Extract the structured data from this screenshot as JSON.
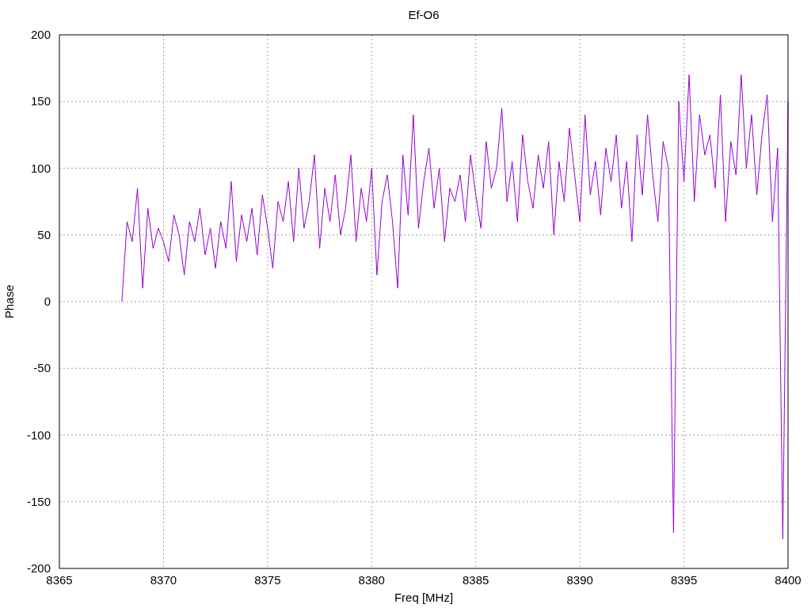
{
  "chart": {
    "chart_data": {
      "type": "line",
      "title": "Ef-O6",
      "xlabel": "Freq [MHz]",
      "ylabel": "Phase",
      "grid": true,
      "xlim": [
        8365,
        8400
      ],
      "ylim": [
        -200,
        200
      ],
      "xticks": [
        8365,
        8370,
        8375,
        8380,
        8385,
        8390,
        8395,
        8400
      ],
      "yticks": [
        -200,
        -150,
        -100,
        -50,
        0,
        50,
        100,
        150,
        200
      ],
      "x": [
        8368,
        8368.25,
        8368.5,
        8368.75,
        8369,
        8369.25,
        8369.5,
        8369.75,
        8370,
        8370.25,
        8370.5,
        8370.75,
        8371,
        8371.25,
        8371.5,
        8371.75,
        8372,
        8372.25,
        8372.5,
        8372.75,
        8373,
        8373.25,
        8373.5,
        8373.75,
        8374,
        8374.25,
        8374.5,
        8374.75,
        8375,
        8375.25,
        8375.5,
        8375.75,
        8376,
        8376.25,
        8376.5,
        8376.75,
        8377,
        8377.25,
        8377.5,
        8377.75,
        8378,
        8378.25,
        8378.5,
        8378.75,
        8379,
        8379.25,
        8379.5,
        8379.75,
        8380,
        8380.25,
        8380.5,
        8380.75,
        8381,
        8381.25,
        8381.5,
        8381.75,
        8382,
        8382.25,
        8382.5,
        8382.75,
        8383,
        8383.25,
        8383.5,
        8383.75,
        8384,
        8384.25,
        8384.5,
        8384.75,
        8385,
        8385.25,
        8385.5,
        8385.75,
        8386,
        8386.25,
        8386.5,
        8386.75,
        8387,
        8387.25,
        8387.5,
        8387.75,
        8388,
        8388.25,
        8388.5,
        8388.75,
        8389,
        8389.25,
        8389.5,
        8389.75,
        8390,
        8390.25,
        8390.5,
        8390.75,
        8391,
        8391.25,
        8391.5,
        8391.75,
        8392,
        8392.25,
        8392.5,
        8392.75,
        8393,
        8393.25,
        8393.5,
        8393.75,
        8394,
        8394.25,
        8394.5,
        8394.75,
        8395,
        8395.25,
        8395.5,
        8395.75,
        8396,
        8396.25,
        8396.5,
        8396.75,
        8397,
        8397.25,
        8397.5,
        8397.75,
        8398,
        8398.25,
        8398.5,
        8398.75,
        8399,
        8399.25,
        8399.5,
        8399.75,
        8400
      ],
      "series": [
        {
          "color": "#9400d3",
          "values": [
            0,
            60,
            45,
            85,
            10,
            70,
            40,
            55,
            45,
            30,
            65,
            50,
            20,
            60,
            45,
            70,
            35,
            55,
            25,
            60,
            40,
            90,
            30,
            65,
            45,
            70,
            35,
            80,
            55,
            25,
            75,
            60,
            90,
            45,
            100,
            55,
            75,
            110,
            40,
            85,
            60,
            95,
            50,
            70,
            110,
            45,
            85,
            60,
            100,
            20,
            75,
            95,
            60,
            10,
            110,
            65,
            140,
            55,
            90,
            115,
            70,
            100,
            45,
            85,
            75,
            95,
            60,
            110,
            80,
            55,
            120,
            85,
            100,
            145,
            75,
            105,
            60,
            125,
            90,
            70,
            110,
            85,
            120,
            50,
            105,
            75,
            130,
            95,
            60,
            140,
            80,
            105,
            65,
            115,
            90,
            125,
            70,
            105,
            45,
            125,
            80,
            140,
            95,
            60,
            120,
            100,
            -173,
            150,
            90,
            170,
            75,
            140,
            110,
            125,
            85,
            155,
            60,
            120,
            95,
            170,
            100,
            140,
            80,
            125,
            155,
            60,
            115,
            -178,
            150
          ]
        }
      ]
    }
  }
}
